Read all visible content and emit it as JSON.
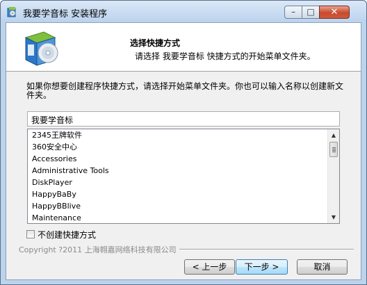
{
  "window": {
    "title": "我要学音标 安装程序",
    "controls": {
      "minimize": "–",
      "maximize": "□",
      "close": "✕"
    }
  },
  "header": {
    "title": "选择快捷方式",
    "subtitle": "请选择 我要学音标 快捷方式的开始菜单文件夹。",
    "icon": "installer-disc-box-icon"
  },
  "body": {
    "instructions": "如果你想要创建程序快捷方式，请选择开始菜单文件夹。你也可以输入名称以创建新文件夹。",
    "folder_input_value": "我要学音标",
    "folder_list": [
      "2345王牌软件",
      "360安全中心",
      "Accessories",
      "Administrative Tools",
      "DiskPlayer",
      "HappyBaBy",
      "HappyBBlive",
      "Maintenance"
    ],
    "no_shortcut_label": "不创建快捷方式",
    "no_shortcut_checked": false
  },
  "footer": {
    "copyright": "Copyright ?2011 上海翱嘉网络科技有限公司",
    "back_label": "< 上一步",
    "next_label": "下一步 >",
    "cancel_label": "取消"
  }
}
